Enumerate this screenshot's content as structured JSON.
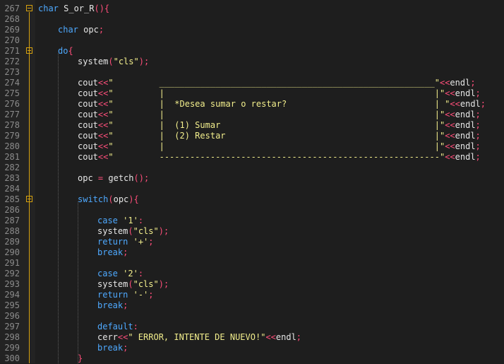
{
  "editor": {
    "lines": [
      {
        "n": "267",
        "fold": true,
        "ind": 0,
        "parts": [
          {
            "t": "k",
            "v": "char"
          },
          {
            "t": "t",
            "v": " S_or_R"
          },
          {
            "t": "p",
            "v": "(){"
          }
        ]
      },
      {
        "n": "268",
        "ind": 0,
        "parts": []
      },
      {
        "n": "269",
        "ind": 4,
        "parts": [
          {
            "t": "k",
            "v": "char"
          },
          {
            "t": "t",
            "v": " opc"
          },
          {
            "t": "p",
            "v": ";"
          }
        ]
      },
      {
        "n": "270",
        "ind": 0,
        "parts": []
      },
      {
        "n": "271",
        "fold": true,
        "ind": 4,
        "parts": [
          {
            "t": "k",
            "v": "do"
          },
          {
            "t": "p",
            "v": "{"
          }
        ]
      },
      {
        "n": "272",
        "ind": 8,
        "parts": [
          {
            "t": "t",
            "v": "system"
          },
          {
            "t": "p",
            "v": "("
          },
          {
            "t": "s",
            "v": "\"cls\""
          },
          {
            "t": "p",
            "v": ");"
          }
        ]
      },
      {
        "n": "273",
        "ind": 0,
        "parts": []
      },
      {
        "n": "274",
        "ind": 8,
        "parts": [
          {
            "t": "t",
            "v": "cout"
          },
          {
            "t": "o",
            "v": "<<"
          },
          {
            "t": "s",
            "v": "\"         ______________________________________________________\""
          },
          {
            "t": "o",
            "v": "<<"
          },
          {
            "t": "t",
            "v": "endl"
          },
          {
            "t": "p",
            "v": ";"
          }
        ]
      },
      {
        "n": "275",
        "ind": 8,
        "parts": [
          {
            "t": "t",
            "v": "cout"
          },
          {
            "t": "o",
            "v": "<<"
          },
          {
            "t": "s",
            "v": "\"         |                                                     |\""
          },
          {
            "t": "o",
            "v": "<<"
          },
          {
            "t": "t",
            "v": "endl"
          },
          {
            "t": "p",
            "v": ";"
          }
        ]
      },
      {
        "n": "276",
        "ind": 8,
        "parts": [
          {
            "t": "t",
            "v": "cout"
          },
          {
            "t": "o",
            "v": "<<"
          },
          {
            "t": "s",
            "v": "\"         |  *Desea sumar o restar?                             | \""
          },
          {
            "t": "o",
            "v": "<<"
          },
          {
            "t": "t",
            "v": "endl"
          },
          {
            "t": "p",
            "v": ";"
          }
        ]
      },
      {
        "n": "277",
        "ind": 8,
        "parts": [
          {
            "t": "t",
            "v": "cout"
          },
          {
            "t": "o",
            "v": "<<"
          },
          {
            "t": "s",
            "v": "\"         |                                                     |\""
          },
          {
            "t": "o",
            "v": "<<"
          },
          {
            "t": "t",
            "v": "endl"
          },
          {
            "t": "p",
            "v": ";"
          }
        ]
      },
      {
        "n": "278",
        "ind": 8,
        "parts": [
          {
            "t": "t",
            "v": "cout"
          },
          {
            "t": "o",
            "v": "<<"
          },
          {
            "t": "s",
            "v": "\"         |  (1) Sumar                                          |\""
          },
          {
            "t": "o",
            "v": "<<"
          },
          {
            "t": "t",
            "v": "endl"
          },
          {
            "t": "p",
            "v": ";"
          }
        ]
      },
      {
        "n": "279",
        "ind": 8,
        "parts": [
          {
            "t": "t",
            "v": "cout"
          },
          {
            "t": "o",
            "v": "<<"
          },
          {
            "t": "s",
            "v": "\"         |  (2) Restar                                         |\""
          },
          {
            "t": "o",
            "v": "<<"
          },
          {
            "t": "t",
            "v": "endl"
          },
          {
            "t": "p",
            "v": ";"
          }
        ]
      },
      {
        "n": "280",
        "ind": 8,
        "parts": [
          {
            "t": "t",
            "v": "cout"
          },
          {
            "t": "o",
            "v": "<<"
          },
          {
            "t": "s",
            "v": "\"         |                                                     |\""
          },
          {
            "t": "o",
            "v": "<<"
          },
          {
            "t": "t",
            "v": "endl"
          },
          {
            "t": "p",
            "v": ";"
          }
        ]
      },
      {
        "n": "281",
        "ind": 8,
        "parts": [
          {
            "t": "t",
            "v": "cout"
          },
          {
            "t": "o",
            "v": "<<"
          },
          {
            "t": "s",
            "v": "\"         -------------------------------------------------------\""
          },
          {
            "t": "o",
            "v": "<<"
          },
          {
            "t": "t",
            "v": "endl"
          },
          {
            "t": "p",
            "v": ";"
          }
        ]
      },
      {
        "n": "282",
        "ind": 0,
        "parts": []
      },
      {
        "n": "283",
        "ind": 8,
        "parts": [
          {
            "t": "t",
            "v": "opc "
          },
          {
            "t": "o",
            "v": "="
          },
          {
            "t": "t",
            "v": " getch"
          },
          {
            "t": "p",
            "v": "();"
          }
        ]
      },
      {
        "n": "284",
        "ind": 0,
        "parts": []
      },
      {
        "n": "285",
        "fold": true,
        "ind": 8,
        "parts": [
          {
            "t": "k",
            "v": "switch"
          },
          {
            "t": "p",
            "v": "("
          },
          {
            "t": "t",
            "v": "opc"
          },
          {
            "t": "p",
            "v": "){"
          }
        ]
      },
      {
        "n": "286",
        "ind": 0,
        "parts": []
      },
      {
        "n": "287",
        "ind": 12,
        "parts": [
          {
            "t": "k",
            "v": "case"
          },
          {
            "t": "t",
            "v": " "
          },
          {
            "t": "s",
            "v": "'1'"
          },
          {
            "t": "p",
            "v": ":"
          }
        ]
      },
      {
        "n": "288",
        "ind": 12,
        "parts": [
          {
            "t": "t",
            "v": "system"
          },
          {
            "t": "p",
            "v": "("
          },
          {
            "t": "s",
            "v": "\"cls\""
          },
          {
            "t": "p",
            "v": ");"
          }
        ]
      },
      {
        "n": "289",
        "ind": 12,
        "parts": [
          {
            "t": "k",
            "v": "return"
          },
          {
            "t": "t",
            "v": " "
          },
          {
            "t": "s",
            "v": "'+'"
          },
          {
            "t": "p",
            "v": ";"
          }
        ]
      },
      {
        "n": "290",
        "ind": 12,
        "parts": [
          {
            "t": "k",
            "v": "break"
          },
          {
            "t": "p",
            "v": ";"
          }
        ]
      },
      {
        "n": "291",
        "ind": 0,
        "parts": []
      },
      {
        "n": "292",
        "ind": 12,
        "parts": [
          {
            "t": "k",
            "v": "case"
          },
          {
            "t": "t",
            "v": " "
          },
          {
            "t": "s",
            "v": "'2'"
          },
          {
            "t": "p",
            "v": ":"
          }
        ]
      },
      {
        "n": "293",
        "ind": 12,
        "parts": [
          {
            "t": "t",
            "v": "system"
          },
          {
            "t": "p",
            "v": "("
          },
          {
            "t": "s",
            "v": "\"cls\""
          },
          {
            "t": "p",
            "v": ");"
          }
        ]
      },
      {
        "n": "294",
        "ind": 12,
        "parts": [
          {
            "t": "k",
            "v": "return"
          },
          {
            "t": "t",
            "v": " "
          },
          {
            "t": "s",
            "v": "'-'"
          },
          {
            "t": "p",
            "v": ";"
          }
        ]
      },
      {
        "n": "295",
        "ind": 12,
        "parts": [
          {
            "t": "k",
            "v": "break"
          },
          {
            "t": "p",
            "v": ";"
          }
        ]
      },
      {
        "n": "296",
        "ind": 0,
        "parts": []
      },
      {
        "n": "297",
        "ind": 12,
        "parts": [
          {
            "t": "k",
            "v": "default"
          },
          {
            "t": "p",
            "v": ":"
          }
        ]
      },
      {
        "n": "298",
        "ind": 12,
        "parts": [
          {
            "t": "t",
            "v": "cerr"
          },
          {
            "t": "o",
            "v": "<<"
          },
          {
            "t": "s",
            "v": "\" ERROR, INTENTE DE NUEVO!\""
          },
          {
            "t": "o",
            "v": "<<"
          },
          {
            "t": "t",
            "v": "endl"
          },
          {
            "t": "p",
            "v": ";"
          }
        ]
      },
      {
        "n": "299",
        "ind": 12,
        "parts": [
          {
            "t": "k",
            "v": "break"
          },
          {
            "t": "p",
            "v": ";"
          }
        ]
      },
      {
        "n": "300",
        "ind": 8,
        "parts": [
          {
            "t": "p",
            "v": "}"
          }
        ]
      }
    ]
  },
  "colors": {
    "background": "#1e1e1e",
    "keyword": "#4ea9ff",
    "string": "#f2ee8c",
    "operator": "#ff4e7a",
    "text": "#e6e6e6",
    "line_number": "#8c8c8c",
    "fold_marker": "#d7a20f"
  }
}
